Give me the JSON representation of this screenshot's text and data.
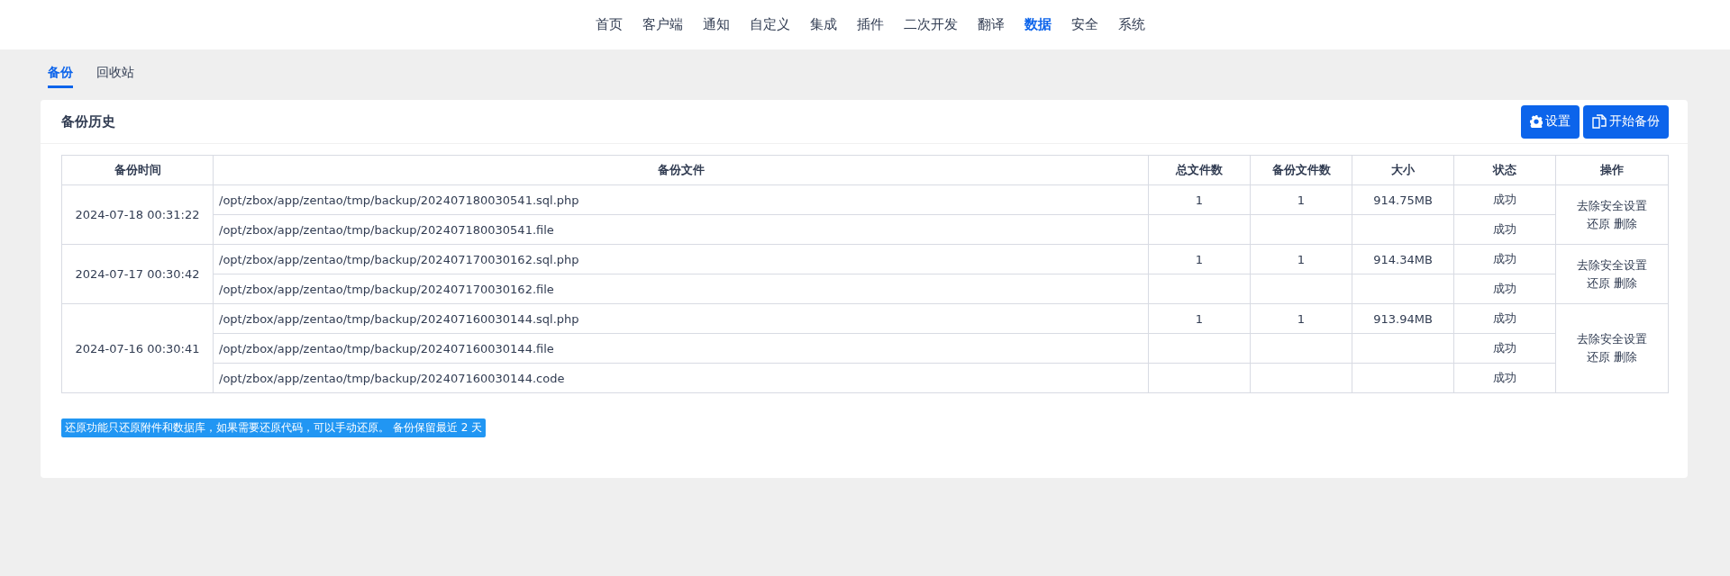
{
  "nav": [
    {
      "label": "首页",
      "selected": false
    },
    {
      "label": "客户端",
      "selected": false
    },
    {
      "label": "通知",
      "selected": false
    },
    {
      "label": "自定义",
      "selected": false
    },
    {
      "label": "集成",
      "selected": false
    },
    {
      "label": "插件",
      "selected": false
    },
    {
      "label": "二次开发",
      "selected": false
    },
    {
      "label": "翻译",
      "selected": false
    },
    {
      "label": "数据",
      "selected": true
    },
    {
      "label": "安全",
      "selected": false
    },
    {
      "label": "系统",
      "selected": false
    }
  ],
  "tabs": [
    {
      "label": "备份",
      "selected": true
    },
    {
      "label": "回收站",
      "selected": false
    }
  ],
  "panel": {
    "title": "备份历史",
    "buttons": [
      {
        "kind": "settings",
        "label": "设置"
      },
      {
        "kind": "backup",
        "label": "开始备份"
      }
    ]
  },
  "table": {
    "columns": [
      "备份时间",
      "备份文件",
      "总文件数",
      "备份文件数",
      "大小",
      "状态",
      "操作"
    ],
    "rows": [
      {
        "time": "2024-07-18 00:31:22",
        "files": [
          {
            "path": "/opt/zbox/app/zentao/tmp/backup/202407180030541.sql.php",
            "total": "1",
            "count": "1",
            "size": "914.75MB",
            "status": "成功"
          },
          {
            "path": "/opt/zbox/app/zentao/tmp/backup/202407180030541.file",
            "status": "成功"
          }
        ],
        "actions": [
          "去除安全设置",
          "还原",
          "删除"
        ]
      },
      {
        "time": "2024-07-17 00:30:42",
        "files": [
          {
            "path": "/opt/zbox/app/zentao/tmp/backup/202407170030162.sql.php",
            "total": "1",
            "count": "1",
            "size": "914.34MB",
            "status": "成功"
          },
          {
            "path": "/opt/zbox/app/zentao/tmp/backup/202407170030162.file",
            "status": "成功"
          }
        ],
        "actions": [
          "去除安全设置",
          "还原",
          "删除"
        ]
      },
      {
        "time": "2024-07-16 00:30:41",
        "files": [
          {
            "path": "/opt/zbox/app/zentao/tmp/backup/202407160030144.sql.php",
            "total": "1",
            "count": "1",
            "size": "913.94MB",
            "status": "成功"
          },
          {
            "path": "/opt/zbox/app/zentao/tmp/backup/202407160030144.file",
            "status": "成功"
          },
          {
            "path": "/opt/zbox/app/zentao/tmp/backup/202407160030144.code",
            "status": "成功"
          }
        ],
        "actions": [
          "去除安全设置",
          "还原",
          "删除"
        ]
      }
    ]
  },
  "note": "还原功能只还原附件和数据库，如果需要还原代码，可以手动还原。 备份保留最近 2 天"
}
